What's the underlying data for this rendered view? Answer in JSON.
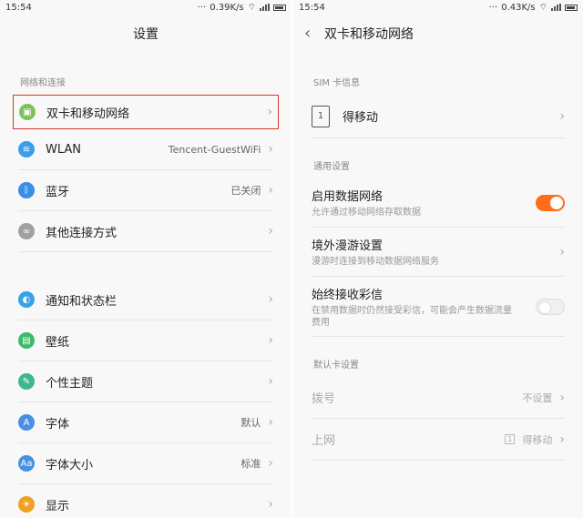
{
  "left": {
    "status": {
      "time": "15:54",
      "speed": "0.39K/s"
    },
    "title": "设置",
    "section_network": "网络和连接",
    "network_items": [
      {
        "label": "双卡和移动网络",
        "value": ""
      },
      {
        "label": "WLAN",
        "value": "Tencent-GuestWiFi"
      },
      {
        "label": "蓝牙",
        "value": "已关闭"
      },
      {
        "label": "其他连接方式",
        "value": ""
      }
    ],
    "other_items": [
      {
        "label": "通知和状态栏",
        "value": ""
      },
      {
        "label": "壁纸",
        "value": ""
      },
      {
        "label": "个性主题",
        "value": ""
      },
      {
        "label": "字体",
        "value": "默认"
      },
      {
        "label": "字体大小",
        "value": "标准"
      },
      {
        "label": "显示",
        "value": ""
      }
    ],
    "icon_colors": {
      "dual_sim": "#7cc35b",
      "wlan": "#3a9ee8",
      "bluetooth": "#3a8ee8",
      "other": "#a0a0a0",
      "notify": "#3aa0e8",
      "wallpaper": "#3cba6b",
      "theme": "#3cba8b",
      "font": "#4a90e2",
      "fontsize": "#4a90e2",
      "display": "#f0a020"
    }
  },
  "right": {
    "status": {
      "time": "15:54",
      "speed": "0.43K/s"
    },
    "title": "双卡和移动网络",
    "section_sim": "SIM 卡信息",
    "sim": {
      "number": "1",
      "name": "得移动"
    },
    "section_general": "通用设置",
    "general": [
      {
        "title": "启用数据网络",
        "sub": "允许通过移动网络存取数据",
        "control": "toggle-on"
      },
      {
        "title": "境外漫游设置",
        "sub": "漫游时连接到移动数据网络服务",
        "control": "chevron"
      },
      {
        "title": "始终接收彩信",
        "sub": "在禁用数据时仍然接受彩信，可能会产生数据流量费用",
        "control": "toggle-off"
      }
    ],
    "section_default": "默认卡设置",
    "default_items": [
      {
        "label": "拨号",
        "value": "不设置"
      },
      {
        "label": "上网",
        "value": "得移动",
        "badge": "1"
      }
    ]
  }
}
